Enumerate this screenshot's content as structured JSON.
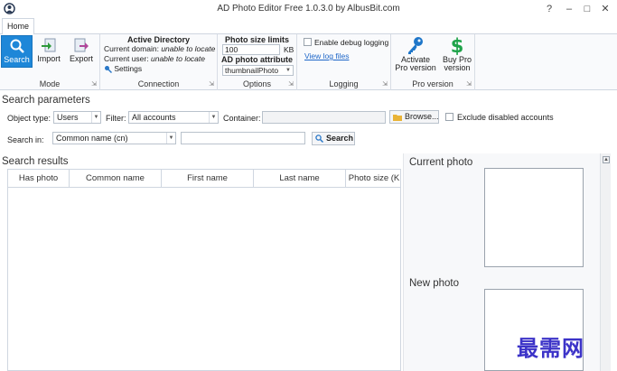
{
  "window": {
    "title": "AD Photo Editor Free 1.0.3.0 by AlbusBit.com",
    "help_glyph": "?",
    "minimize_glyph": "–",
    "maximize_glyph": "□",
    "close_glyph": "✕"
  },
  "ribbon": {
    "tabs": [
      "Home"
    ],
    "mode": {
      "label": "Mode",
      "search": "Search",
      "import": "Import",
      "export": "Export"
    },
    "connection": {
      "label": "Connection",
      "title": "Active Directory",
      "domain_label": "Current domain:",
      "domain_value": "unable to locate",
      "user_label": "Current user:",
      "user_value": "unable to locate",
      "settings": "Settings"
    },
    "options": {
      "label": "Options",
      "size_title": "Photo size limits",
      "size_value": "100",
      "size_unit": "KB",
      "attr_title": "AD photo attribute",
      "attr_value": "thumbnailPhoto"
    },
    "logging": {
      "label": "Logging",
      "debug_label": "Enable debug logging",
      "view_log": "View log files"
    },
    "pro": {
      "label": "Pro version",
      "activate_line1": "Activate",
      "activate_line2": "Pro version",
      "buy_line1": "Buy Pro",
      "buy_line2": "version"
    },
    "launcher_glyph": "⇲"
  },
  "search_params": {
    "title": "Search parameters",
    "object_type_label": "Object type:",
    "object_type_value": "Users",
    "filter_label": "Filter:",
    "filter_value": "All accounts",
    "container_label": "Container:",
    "browse_label": "Browse...",
    "exclude_label": "Exclude disabled accounts",
    "search_in_label": "Search in:",
    "search_in_value": "Common name (cn)",
    "search_button": "Search"
  },
  "results": {
    "title": "Search results",
    "columns": [
      "Has photo",
      "Common name",
      "First name",
      "Last name",
      "Photo size (K"
    ]
  },
  "photos": {
    "current_title": "Current photo",
    "new_title": "New photo"
  },
  "watermark": "最需网",
  "colors": {
    "accent": "#1e87d8",
    "link": "#1e66c8",
    "pro_key": "#1e76c9",
    "pro_dollar": "#1fa34a",
    "watermark": "#3c33c8"
  }
}
